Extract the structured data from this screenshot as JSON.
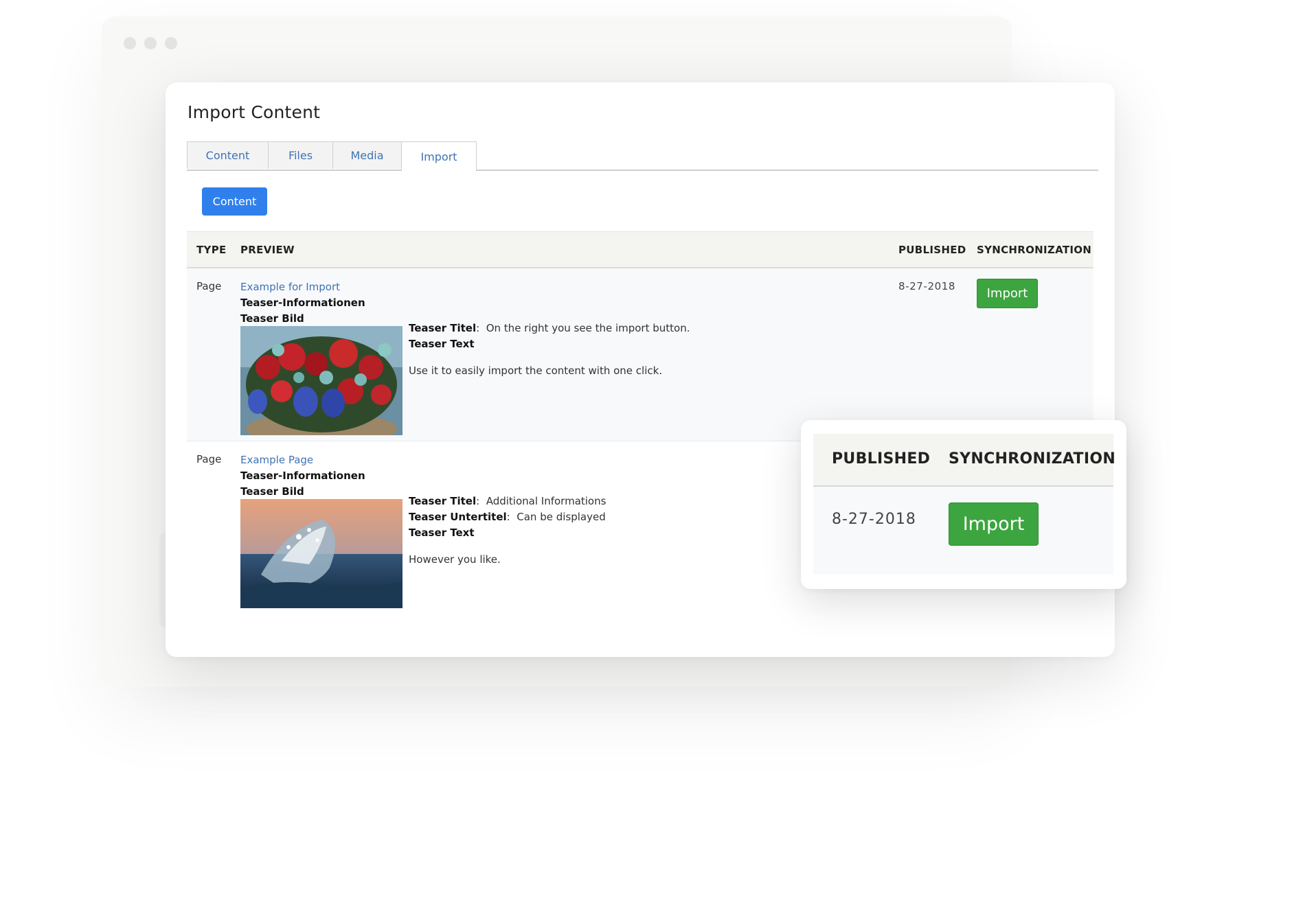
{
  "page": {
    "title": "Import Content"
  },
  "tabs": [
    {
      "label": "Content",
      "active": false
    },
    {
      "label": "Files",
      "active": false
    },
    {
      "label": "Media",
      "active": false
    },
    {
      "label": "Import",
      "active": true
    }
  ],
  "toolbar": {
    "content_button": "Content"
  },
  "table": {
    "headers": {
      "type": "TYPE",
      "preview": "PREVIEW",
      "published": "PUBLISHED",
      "synchronization": "SYNCHRONIZATION"
    },
    "rows": [
      {
        "type": "Page",
        "title": "Example for Import",
        "info_heading": "Teaser-Informationen",
        "image_heading": "Teaser Bild",
        "image_icon": "flower-bouquet-image",
        "teaser_title_label": "Teaser Titel",
        "teaser_title": "On the right you see the import button.",
        "teaser_text_label": "Teaser Text",
        "teaser_text": "Use it to easily import the content with one click.",
        "published": "8-27-2018",
        "action": "Import"
      },
      {
        "type": "Page",
        "title": "Example Page",
        "info_heading": "Teaser-Informationen",
        "image_heading": "Teaser Bild",
        "image_icon": "ocean-wave-image",
        "teaser_title_label": "Teaser Titel",
        "teaser_title": "Additional Informations",
        "teaser_subtitle_label": "Teaser Untertitel",
        "teaser_subtitle": "Can be displayed",
        "teaser_text_label": "Teaser Text",
        "teaser_text": "However you like."
      }
    ]
  },
  "zoom": {
    "published_header": "PUBLISHED",
    "sync_header": "SYNCHRONIZATION",
    "date": "8-27-2018",
    "button": "Import"
  },
  "colors": {
    "link": "#3f73b2",
    "primary": "#2f80ed",
    "success": "#3ca53f",
    "header_bg": "#f4f4f1",
    "row_bg": "#f7f9fb"
  }
}
